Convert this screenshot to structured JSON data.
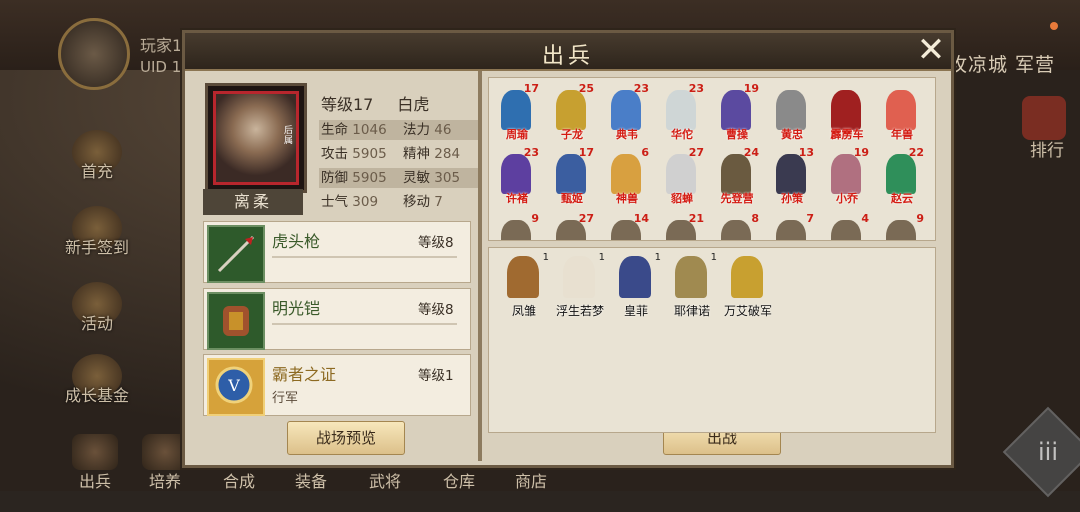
{
  "player": {
    "name": "玩家1",
    "uid": "UID 1"
  },
  "side_menu": [
    {
      "label": "首充",
      "icon": "gift-icon"
    },
    {
      "label": "新手签到",
      "icon": "checkin-icon"
    },
    {
      "label": "活动",
      "icon": "event-icon"
    },
    {
      "label": "成长基金",
      "icon": "fund-icon"
    }
  ],
  "bottom_nav": [
    {
      "label": "出兵"
    },
    {
      "label": "培养"
    },
    {
      "label": "合成"
    },
    {
      "label": "装备"
    },
    {
      "label": "武将"
    },
    {
      "label": "仓库"
    },
    {
      "label": "商店"
    }
  ],
  "top_right": "攻凉城 军营",
  "rank_label": "排行",
  "menu_label": "iii",
  "dialog": {
    "title": "出兵",
    "close": "✕",
    "general": {
      "name": "离柔",
      "portrait_tag": "后属",
      "level_label": "等级17",
      "class": "白虎",
      "stats": [
        {
          "label": "生命",
          "value": "1046"
        },
        {
          "label": "法力",
          "value": "46"
        },
        {
          "label": "攻击",
          "value": "5905"
        },
        {
          "label": "精神",
          "value": "284"
        },
        {
          "label": "防御",
          "value": "5905"
        },
        {
          "label": "灵敏",
          "value": "305"
        },
        {
          "label": "士气",
          "value": "309"
        },
        {
          "label": "移动",
          "value": "7"
        }
      ]
    },
    "equipment": [
      {
        "name": "虎头枪",
        "level": "等级8",
        "sub": "",
        "icon": "spear-icon"
      },
      {
        "name": "明光铠",
        "level": "等级8",
        "sub": "",
        "icon": "armor-icon"
      },
      {
        "name": "霸者之证",
        "level": "等级1",
        "sub": "行军",
        "icon": "badge-icon"
      }
    ],
    "preview_button": "战场预览",
    "battle_button": "出战",
    "hero_grid": [
      {
        "name": "周瑜",
        "level": "17",
        "color": "#2f6fb0"
      },
      {
        "name": "子龙",
        "level": "25",
        "color": "#c7a030"
      },
      {
        "name": "典韦",
        "level": "23",
        "color": "#4a7ec8"
      },
      {
        "name": "华佗",
        "level": "23",
        "color": "#cfd6d6"
      },
      {
        "name": "曹操",
        "level": "19",
        "color": "#5b4aa0"
      },
      {
        "name": "黄忠",
        "level": "",
        "color": "#8a8a8a"
      },
      {
        "name": "霹雳车",
        "level": "",
        "color": "#a02020"
      },
      {
        "name": "年兽",
        "level": "",
        "color": "#e06050"
      },
      {
        "name": "许褚",
        "level": "23",
        "color": "#5d3fa0"
      },
      {
        "name": "甄姬",
        "level": "17",
        "color": "#3b5ea0"
      },
      {
        "name": "神兽",
        "level": "6",
        "color": "#d8a040"
      },
      {
        "name": "貂蝉",
        "level": "27",
        "color": "#d0d0d0"
      },
      {
        "name": "先登营",
        "level": "24",
        "color": "#6a5a40"
      },
      {
        "name": "孙策",
        "level": "13",
        "color": "#3a3a50"
      },
      {
        "name": "小乔",
        "level": "19",
        "color": "#b07080"
      },
      {
        "name": "赵云",
        "level": "22",
        "color": "#2f8f5a"
      }
    ],
    "row3_levels": [
      "9",
      "27",
      "14",
      "21",
      "8",
      "7",
      "4",
      "9"
    ],
    "selected_heroes": [
      {
        "name": "凤雏",
        "level": "1",
        "color": "#a06a30"
      },
      {
        "name": "浮生若梦",
        "level": "1",
        "color": "#e8e0d0"
      },
      {
        "name": "皇菲",
        "level": "1",
        "color": "#3a4a8a"
      },
      {
        "name": "耶律诺",
        "level": "1",
        "color": "#a08a50"
      },
      {
        "name": "万艾破军",
        "level": "",
        "color": "#c8a030"
      }
    ]
  }
}
